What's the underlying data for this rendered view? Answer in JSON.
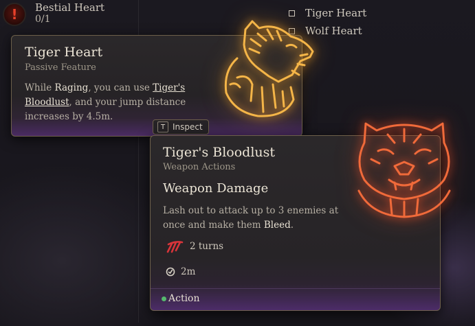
{
  "quest": {
    "title": "Bestial Heart",
    "count": "0/1"
  },
  "checklist": [
    {
      "label": "Tiger Heart"
    },
    {
      "label": "Wolf Heart"
    }
  ],
  "tooltip_passive": {
    "title": "Tiger Heart",
    "subtitle": "Passive Feature",
    "desc_part1": "While ",
    "desc_raging": "Raging",
    "desc_part2": ", you can use ",
    "desc_link": "Tiger's Bloodlust",
    "desc_part3": ", and your jump distance increases by 4.5m.",
    "icon": "tiger-heart-icon",
    "inspect_key": "T",
    "inspect_label": "Inspect"
  },
  "tooltip_action": {
    "title": "Tiger's Bloodlust",
    "subtitle": "Weapon Actions",
    "heading": "Weapon Damage",
    "desc_part1": "Lash out to attack up to 3 enemies at once and make them ",
    "desc_bleed": "Bleed",
    "desc_part2": ".",
    "duration": "2 turns",
    "range": "2m",
    "cost": "Action",
    "icon": "tigers-bloodlust-icon"
  },
  "colors": {
    "gold_glow": "#e79a2a",
    "red_glow": "#e8502a",
    "card_border": "#6d604a",
    "purple_footer": "#4a2b63",
    "action_dot": "#56b86e"
  }
}
